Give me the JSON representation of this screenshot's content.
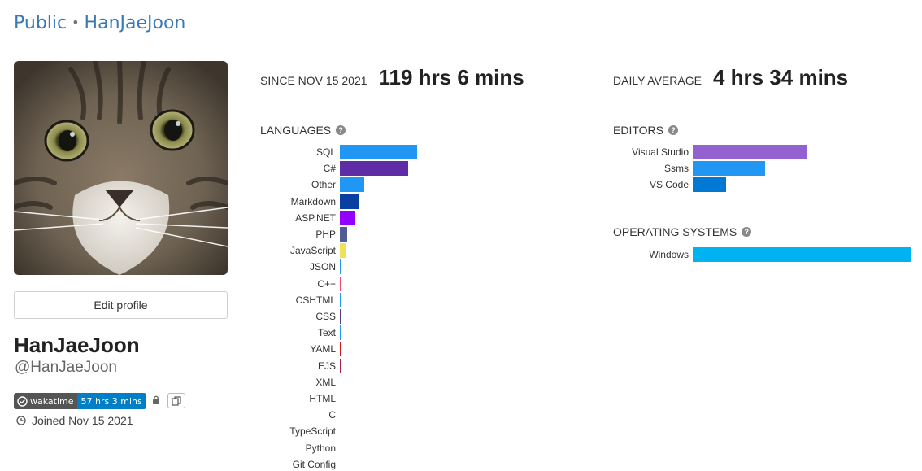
{
  "breadcrumb": {
    "public": "Public",
    "separator": "•",
    "user": "HanJaeJoon"
  },
  "profile": {
    "edit_label": "Edit profile",
    "display_name": "HanJaeJoon",
    "username": "@HanJaeJoon",
    "badge_label": "wakatime",
    "badge_value": "57 hrs 3 mins",
    "joined": "Joined Nov 15 2021"
  },
  "stats": {
    "since_label": "SINCE NOV 15 2021",
    "since_value": "119 hrs 6 mins",
    "avg_label": "DAILY AVERAGE",
    "avg_value": "4 hrs 34 mins"
  },
  "languages": {
    "title": "LANGUAGES",
    "items": [
      {
        "name": "SQL",
        "percent": 35.0,
        "color": "#2196f3"
      },
      {
        "name": "C#",
        "percent": 31.0,
        "color": "#5e2ca5"
      },
      {
        "name": "Other",
        "percent": 11.0,
        "color": "#2196f3"
      },
      {
        "name": "Markdown",
        "percent": 8.5,
        "color": "#083fa1"
      },
      {
        "name": "ASP.NET",
        "percent": 7.0,
        "color": "#9400ff"
      },
      {
        "name": "PHP",
        "percent": 3.5,
        "color": "#4f5d95"
      },
      {
        "name": "JavaScript",
        "percent": 2.5,
        "color": "#f1e05a"
      },
      {
        "name": "JSON",
        "percent": 0.8,
        "color": "#2196f3"
      },
      {
        "name": "C++",
        "percent": 0.7,
        "color": "#f34b7d"
      },
      {
        "name": "CSHTML",
        "percent": 0.6,
        "color": "#2196f3"
      },
      {
        "name": "CSS",
        "percent": 0.5,
        "color": "#563d7c"
      },
      {
        "name": "Text",
        "percent": 0.4,
        "color": "#2196f3"
      },
      {
        "name": "YAML",
        "percent": 0.4,
        "color": "#cb171e"
      },
      {
        "name": "EJS",
        "percent": 0.4,
        "color": "#a91e50"
      },
      {
        "name": "XML",
        "percent": 0,
        "color": "#0060ac"
      },
      {
        "name": "HTML",
        "percent": 0,
        "color": "#e34c26"
      },
      {
        "name": "C",
        "percent": 0,
        "color": "#555555"
      },
      {
        "name": "TypeScript",
        "percent": 0,
        "color": "#2b7489"
      },
      {
        "name": "Python",
        "percent": 0,
        "color": "#3572a5"
      },
      {
        "name": "Git Config",
        "percent": 0,
        "color": "#f44d27"
      }
    ]
  },
  "editors": {
    "title": "EDITORS",
    "items": [
      {
        "name": "Visual Studio",
        "percent": 52,
        "color": "#9361d0"
      },
      {
        "name": "Ssms",
        "percent": 33,
        "color": "#2196f3"
      },
      {
        "name": "VS Code",
        "percent": 15,
        "color": "#0078d4"
      }
    ]
  },
  "os": {
    "title": "OPERATING SYSTEMS",
    "items": [
      {
        "name": "Windows",
        "percent": 100,
        "color": "#00b3f0"
      }
    ]
  },
  "icons": {
    "help": "help-icon",
    "lock": "lock-icon",
    "copy": "copy-icon",
    "clock": "clock-icon",
    "wakatime": "wakatime-logo-icon"
  }
}
